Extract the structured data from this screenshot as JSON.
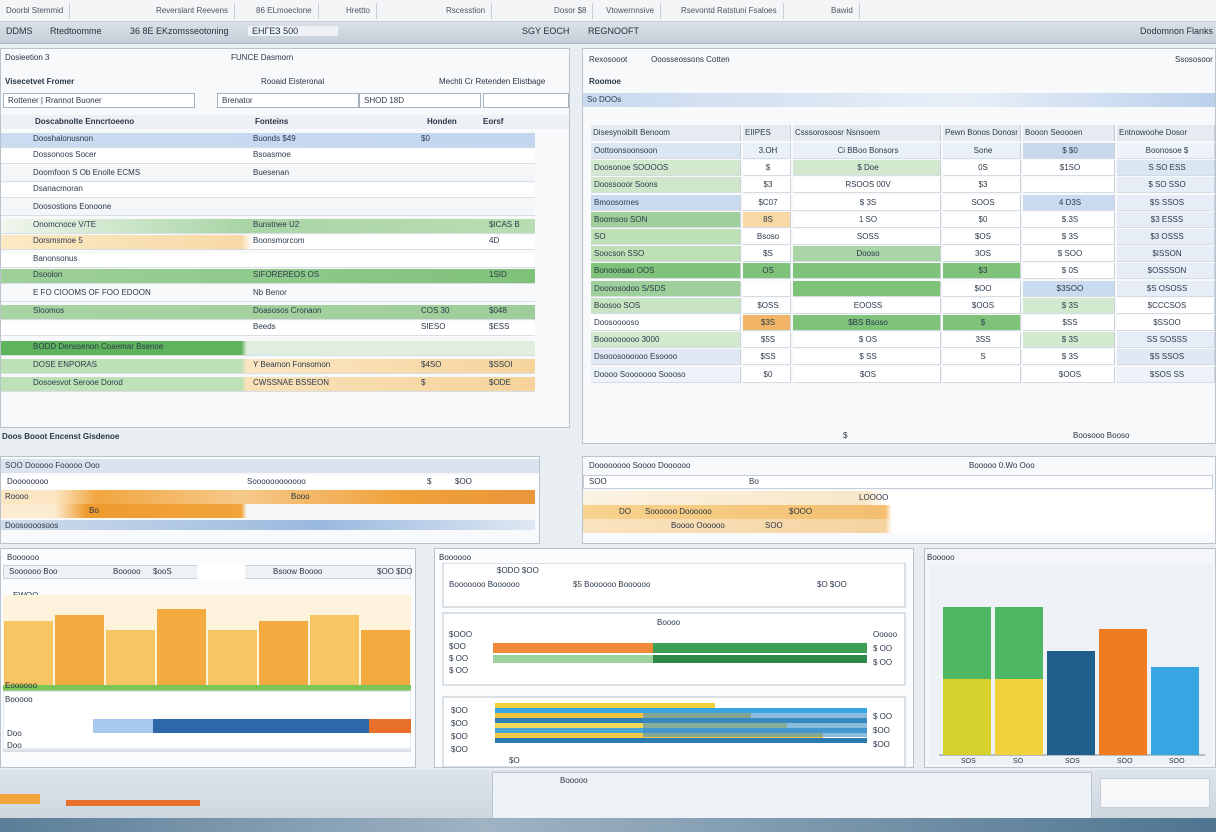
{
  "tabs": [
    "Doorbl Stemmid",
    "Reverslant Reevens",
    "86 ELmoeclone",
    "Hrettto",
    "Rscesstion",
    "Dosor  $8",
    "Vtowernnsive",
    "Rsevontd Ratstuni Fsaloes",
    "Bawid"
  ],
  "toolbar": {
    "left": "DDMS",
    "mid1": "Rtedtoomme",
    "mid2": "36 8E   EKzomsseotoning",
    "mid3": "ЕНГЕЗ 500",
    "center": "SGY  EOCH",
    "center2": "REGNOOFT",
    "right": "Dodomnon Flanks"
  },
  "left_panel": {
    "crumb1": "Dosieetion 3",
    "crumb2": "FUNCE Dasmorn",
    "title": "Visecetvet Fromer",
    "title_right": "Rooaid Eisteronal",
    "title_far": "Mechti Cr Retenden Elistbage",
    "filter1": "Rottener",
    "filter2": "Rrannot Buoner",
    "filter3": "Brenator",
    "filter4": "SHOD   18D",
    "col_a": "Doscabnolte Enncrtoeeno",
    "col_b": "Fonteins",
    "col_c": "Honden",
    "col_d": "Eorsf",
    "rows": [
      {
        "a": "Dooshalonusnon",
        "b": "Buonds $49",
        "c": "$0",
        "d": ""
      },
      {
        "a": "Dossonoos Socer",
        "b": "Bsoasmoe",
        "c": "",
        "d": ""
      },
      {
        "a": "Doomfoon S Ob Enolle  ECMS",
        "b": "Buesenan",
        "c": "",
        "d": ""
      },
      {
        "a": "Dsanacmoran",
        "b": "",
        "c": "",
        "d": ""
      },
      {
        "a": "Doosostions Eonoone",
        "b": "",
        "c": "",
        "d": ""
      },
      {
        "a": "Onomcnoce V/TE",
        "b": "Bunstnee U2",
        "c": "",
        "d": "$ICAS B"
      },
      {
        "a": "Dorsmsmoe 5",
        "b": "Boonsmorcom",
        "c": "",
        "d": "4D"
      },
      {
        "a": "Banonsonus",
        "b": "",
        "c": "",
        "d": ""
      },
      {
        "a": "Dsoolon",
        "b": "SIFOREREOS OS",
        "c": "",
        "d": "1SID"
      },
      {
        "a": "E FO CIOOMS OF FOO EDOON",
        "b": "Nb Benor",
        "c": "",
        "d": ""
      },
      {
        "a": "Sloomos",
        "b": "Doasosos Cronaon",
        "c": "COS 30",
        "d": "$048"
      },
      {
        "a": "",
        "b": "Beeds",
        "c": "SIESO",
        "d": "$ESS"
      },
      {
        "a": "BODD Denssenon Coaemar Bsenoe",
        "b": "",
        "c": "",
        "d": ""
      },
      {
        "a": "DOSE ENPORAS",
        "b": "Y Beamon Fonsomon",
        "c": "$4SO",
        "d": "$SSOI"
      },
      {
        "a": "Dosoesvot Serooe Dorod",
        "b": "CWSSNAE BSSEON",
        "c": "$",
        "d": "$ODE"
      }
    ],
    "footer": "Doos Booot Encenst Gisdenoe"
  },
  "right_panel": {
    "crumb1": "Rexosooot",
    "crumb2": "Ooosseossons Cotten",
    "crumb_right": "Ssososoor",
    "title": "Roomoe",
    "subtitle": "So DOOs",
    "headers": [
      "Disesynoibilt Benoom",
      "EIIPES",
      "Csssorosoosr Nsnsoem",
      "Pewn Bonos Donosr",
      "Booon Seoooen",
      "Entnowoohe Dosor"
    ],
    "rows": [
      [
        "Oottoonsoonsoon",
        "3.OH",
        "Ci BBoo Bonsors",
        "Sone",
        "$ $0",
        "Boonosoe  $"
      ],
      [
        "Doosonoe SOOOOS",
        "$",
        "$ Doe",
        "0S",
        "$1SO",
        "S SO ESS"
      ],
      [
        "Doossooor Soons",
        "$3",
        "RSOOS 00V",
        "$3",
        "",
        "$ SO SSO"
      ],
      [
        "Bmoosornes",
        "$C07",
        "$ 3S",
        "SOOS",
        "4 D3S",
        "$S SSOS"
      ],
      [
        "Boomsoo  SON",
        "8S",
        "1 SO",
        "$0",
        "$.3S",
        "$3 ESSS"
      ],
      [
        "SO",
        "Bsoso",
        "SOSS",
        "$OS",
        "$ 3S",
        "$3 OSSS"
      ],
      [
        "Soocson SSO",
        "$S",
        "Dooso",
        "3OS",
        "$ SOO",
        "$ISSON"
      ],
      [
        "Bonooosao OOS",
        "OS",
        "",
        "$3",
        "$ 0S",
        "$OSSSON"
      ],
      [
        "Doooosodoo S/SDS",
        "",
        "",
        "$OO",
        "$3SOO",
        "$S OSOSS"
      ],
      [
        "Boosoo SOS",
        "$OSS",
        "EOOSS",
        "$OOS",
        "$ 3S",
        "$CCCSOS"
      ],
      [
        "Doosooooso",
        "$3S",
        "$BS Bsoso",
        "$",
        "$SS",
        "$SSOO"
      ],
      [
        "Booooooooo 3000",
        "$5S",
        "$ OS",
        "3SS",
        "$ 3S",
        "SS SOSSS"
      ],
      [
        "Dsooosoooooo Esoooo",
        "$SS",
        "$ SS",
        "S",
        "$ 3S",
        "$S SSOS"
      ],
      [
        "Doooo Sooooooo Soooso",
        "$0",
        "$OS",
        "",
        "$OOS",
        "$SOS SS"
      ]
    ],
    "footer_left": "$",
    "footer_right": "Boosooo Booso"
  },
  "mid_left": {
    "title": "Bdoo Booon Sssooos",
    "header": "SOO Dooooo Fooooo Ooo",
    "row1_a": "Doooooooo",
    "row1_b": "Soooooooooooo",
    "row1_c": "$",
    "row1_d": "$OO",
    "row2_a": "Roooo",
    "row2_b": "Booo",
    "row3": "Bo",
    "row4": "Doosoooosoos"
  },
  "mid_right": {
    "title": "Doooooooo Soooo Doooooo",
    "title_right": "Booooo 0.Wo Ooo",
    "row1": "SOO",
    "row1_b": "Bo",
    "row2": "LOOOO",
    "row3_a": "DO",
    "row3_b": "Soooooo Doooooo",
    "row3_c": "$OOO",
    "row4": "Boooo Oooooo",
    "row4_b": "SOO"
  },
  "chart_left": {
    "title": "Boooooo",
    "sub_a": "Soooooo Boo",
    "sub_b": "Booooo",
    "sub_c": "$ooS",
    "sub_d": "Bsoow Boooo",
    "sub_e": "$OO $DO",
    "side_label": "EWOO",
    "legend1": "Eoooooo",
    "legend2": "Booooo",
    "legend3": "Doo",
    "legend4": "Doo",
    "bars_orange_levels": [
      0.7,
      0.8,
      0.55,
      0.9,
      0.55,
      0.7,
      0.8,
      0.55
    ]
  },
  "chart_mid": {
    "title": "Boooooo",
    "header": "$ODO $OO",
    "sub1": "Booooooo Boooooo",
    "sub2": "$5 Boooooo Boooooo",
    "sub3": "$O $OO",
    "sub4": "Boooo",
    "row_labels": [
      "$OOO",
      "$OO",
      "$ OO",
      "$ OO"
    ],
    "right_labels": [
      "Ooooo",
      "$ OO",
      "$ OO"
    ],
    "bottom_labels": [
      "$OO",
      "$OO",
      "$OO",
      "$OO"
    ],
    "bottom_right": [
      "$ OO",
      "$OO",
      "$OO"
    ],
    "x_label": "$O"
  },
  "chart_right": {
    "title": "Booooo",
    "type": "bar",
    "x_labels": [
      "SOS",
      "SO",
      "SOS",
      "SOO",
      "SOO"
    ]
  },
  "status": {
    "label": "Booooo"
  },
  "colors": {
    "green": "#4db764",
    "blue": "#1f5f8b",
    "orange": "#f07b22",
    "sky": "#37a6e3",
    "yellow": "#f2d23a",
    "olive": "#d7d12d"
  }
}
